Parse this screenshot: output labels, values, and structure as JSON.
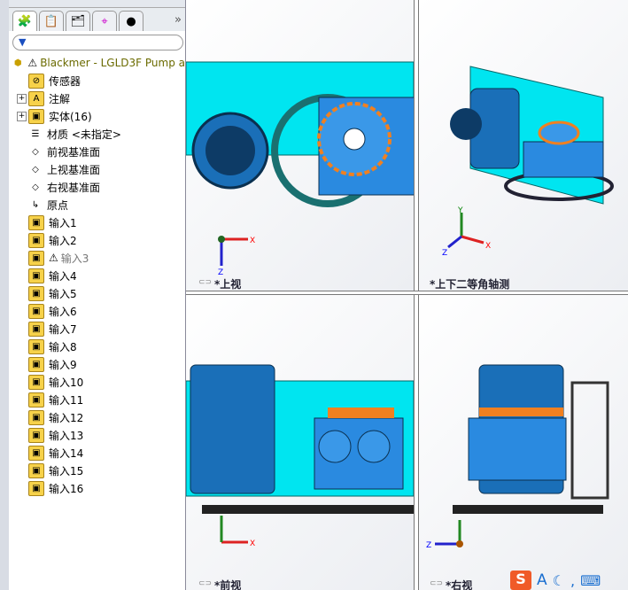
{
  "panel": {
    "tabs": [
      "feature-manager",
      "property-manager",
      "configuration-manager",
      "dimxpert-manager",
      "display-manager"
    ],
    "more": "»",
    "filter_icon": "▼",
    "root": "Blackmer - LGLD3F Pump a",
    "items": [
      {
        "label": "传感器",
        "icon": "sensor",
        "expand": false
      },
      {
        "label": "注解",
        "icon": "annotations",
        "expand": true
      },
      {
        "label": "实体(16)",
        "icon": "bodies",
        "expand": true
      },
      {
        "label": "材质 <未指定>",
        "icon": "material",
        "expand": false
      },
      {
        "label": "前视基准面",
        "icon": "plane",
        "expand": false
      },
      {
        "label": "上视基准面",
        "icon": "plane",
        "expand": false
      },
      {
        "label": "右视基准面",
        "icon": "plane",
        "expand": false
      },
      {
        "label": "原点",
        "icon": "origin",
        "expand": false
      },
      {
        "label": "输入1",
        "icon": "import"
      },
      {
        "label": "输入2",
        "icon": "import"
      },
      {
        "label": "输入3",
        "icon": "import",
        "warning": true
      },
      {
        "label": "输入4",
        "icon": "import"
      },
      {
        "label": "输入5",
        "icon": "import"
      },
      {
        "label": "输入6",
        "icon": "import"
      },
      {
        "label": "输入7",
        "icon": "import"
      },
      {
        "label": "输入8",
        "icon": "import"
      },
      {
        "label": "输入9",
        "icon": "import"
      },
      {
        "label": "输入10",
        "icon": "import"
      },
      {
        "label": "输入11",
        "icon": "import"
      },
      {
        "label": "输入12",
        "icon": "import"
      },
      {
        "label": "输入13",
        "icon": "import"
      },
      {
        "label": "输入14",
        "icon": "import"
      },
      {
        "label": "输入15",
        "icon": "import"
      },
      {
        "label": "输入16",
        "icon": "import"
      }
    ]
  },
  "views": {
    "top": "*上视",
    "iso": "*上下二等角轴测",
    "front": "*前视",
    "right": "*右视"
  },
  "axes": {
    "x": "X",
    "y": "Y",
    "z": "Z"
  },
  "taskbar": {
    "ime": "S",
    "a": "A"
  },
  "colors": {
    "cyan": "#00e5f0",
    "blue": "#2a8ae0",
    "orange": "#f08020"
  }
}
